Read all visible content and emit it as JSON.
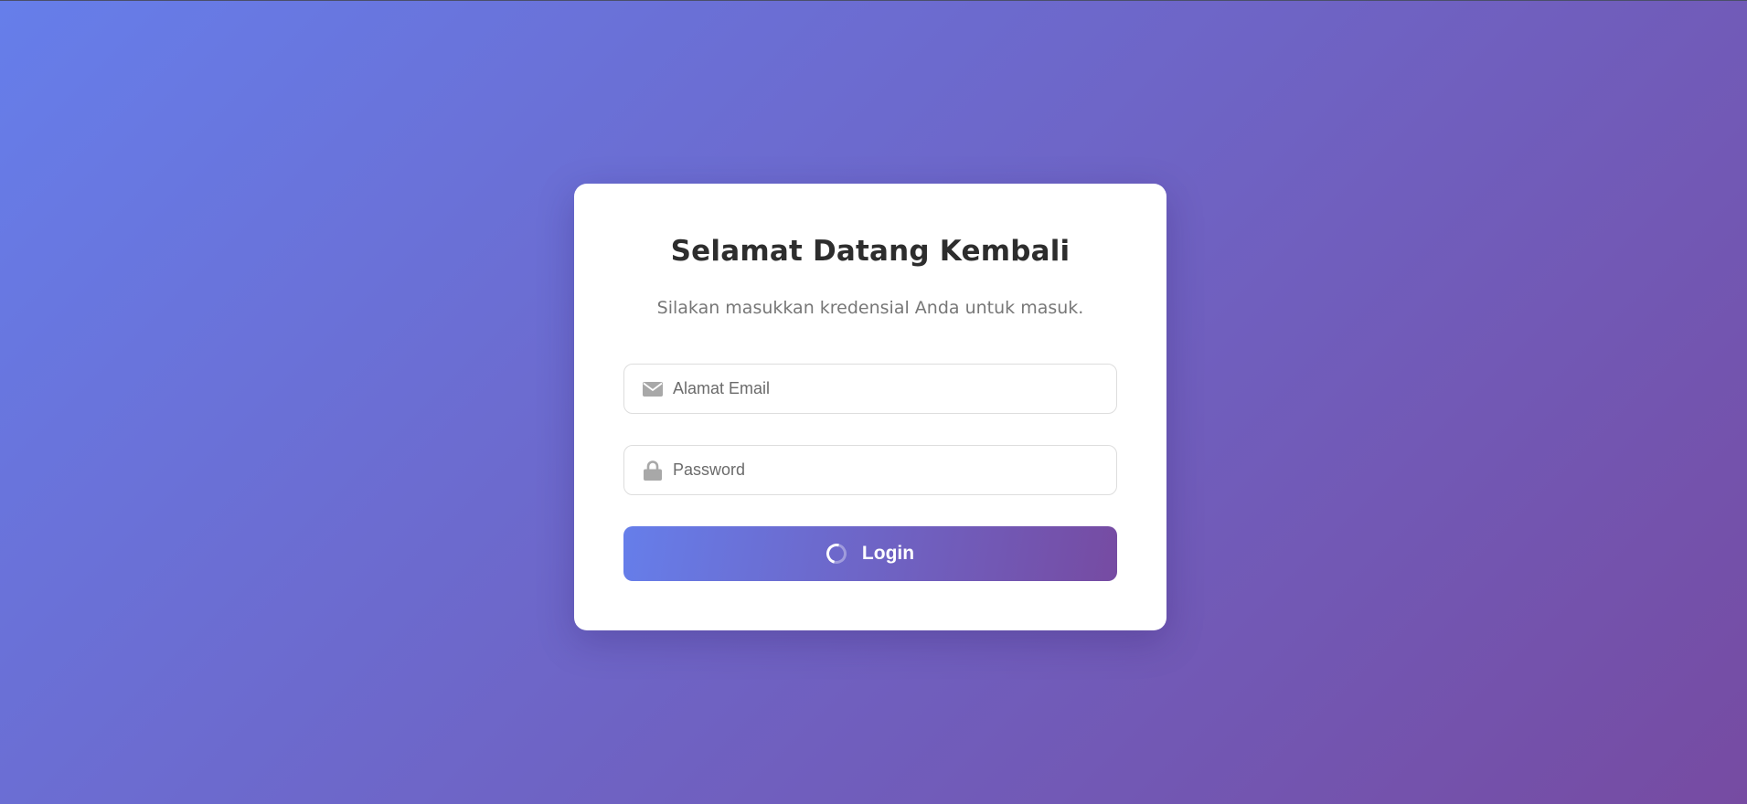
{
  "login_card": {
    "title": "Selamat Datang Kembali",
    "subtitle": "Silakan masukkan kredensial Anda untuk masuk.",
    "email": {
      "icon": "envelope-icon",
      "placeholder": "Alamat Email",
      "value": ""
    },
    "password": {
      "icon": "lock-icon",
      "placeholder": "Password",
      "value": ""
    },
    "submit": {
      "label": "Login",
      "state": "loading",
      "spinner_icon": "spinner-icon"
    }
  },
  "colors": {
    "gradient_start": "#667eea",
    "gradient_end": "#764ba2",
    "title": "#2d2d2d",
    "subtitle": "#777777",
    "icon": "#a8a8a8"
  }
}
